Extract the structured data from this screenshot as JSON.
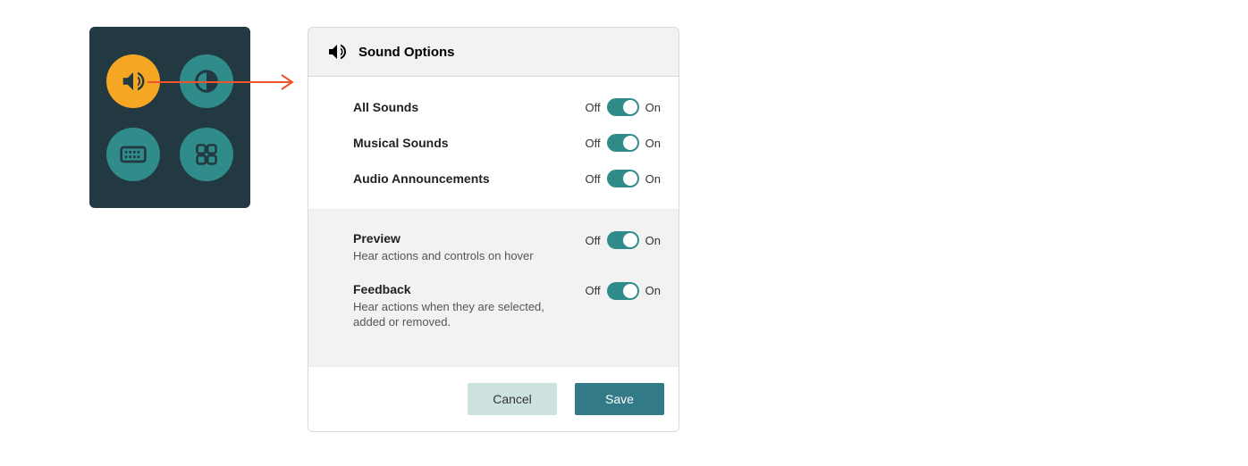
{
  "launcher": {
    "items": [
      {
        "name": "sound",
        "active": true
      },
      {
        "name": "contrast",
        "active": false
      },
      {
        "name": "keyboard",
        "active": false
      },
      {
        "name": "apps",
        "active": false
      }
    ]
  },
  "dialog": {
    "title": "Sound Options",
    "off_label": "Off",
    "on_label": "On",
    "primary_options": [
      {
        "label": "All Sounds",
        "on": true
      },
      {
        "label": "Musical Sounds",
        "on": true
      },
      {
        "label": "Audio Announcements",
        "on": true
      }
    ],
    "secondary_options": [
      {
        "label": "Preview",
        "desc": "Hear actions and controls on hover",
        "on": true
      },
      {
        "label": "Feedback",
        "desc": "Hear actions when they are selected, added or removed.",
        "on": true
      }
    ],
    "cancel_label": "Cancel",
    "save_label": "Save"
  }
}
